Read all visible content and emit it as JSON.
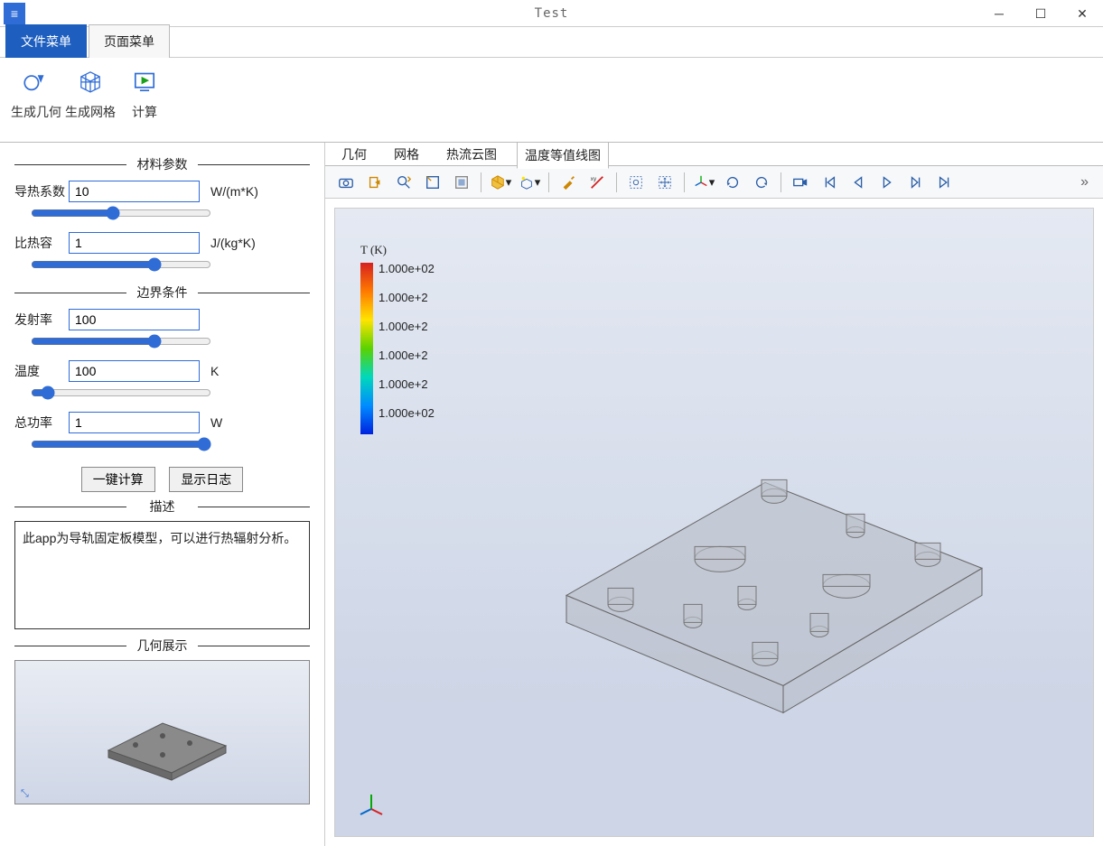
{
  "window": {
    "title": "Test"
  },
  "menu_tabs": {
    "file": "文件菜单",
    "page": "页面菜单"
  },
  "ribbon": {
    "gen_geom": "生成几何",
    "gen_mesh": "生成网格",
    "compute": "计算"
  },
  "groups": {
    "material": "材料参数",
    "boundary": "边界条件",
    "description": "描述",
    "geom_preview": "几何展示"
  },
  "params": {
    "conductivity": {
      "label": "导热系数",
      "value": "10",
      "unit": "W/(m*K)"
    },
    "specific_heat": {
      "label": "比热容",
      "value": "1",
      "unit": "J/(kg*K)"
    },
    "emissivity": {
      "label": "发射率",
      "value": "100",
      "unit": ""
    },
    "temperature": {
      "label": "温度",
      "value": "100",
      "unit": "K"
    },
    "power": {
      "label": "总功率",
      "value": "1",
      "unit": "W"
    }
  },
  "buttons": {
    "onekey": "一键计算",
    "showlog": "显示日志"
  },
  "description_text": "此app为导轨固定板模型，可以进行热辐射分析。",
  "view_tabs": {
    "geom": "几何",
    "mesh": "网格",
    "heatflux": "热流云图",
    "isotherm": "温度等值线图"
  },
  "legend": {
    "title": "T (K)",
    "ticks": [
      "1.000e+02",
      "1.000e+2",
      "1.000e+2",
      "1.000e+2",
      "1.000e+2",
      "1.000e+02"
    ]
  },
  "toolbar_icons": [
    "camera",
    "export",
    "zoom-fit",
    "zoom-region",
    "zoom-select",
    "cube-dropdown",
    "light-cube",
    "brush",
    "cut-axis",
    "selection-zoom",
    "selection-move",
    "axis-triad",
    "rotate-ccw",
    "rotate-cw",
    "camera-rec",
    "skip-start",
    "step-back",
    "play",
    "step-fwd",
    "skip-end"
  ],
  "overflow": "»"
}
